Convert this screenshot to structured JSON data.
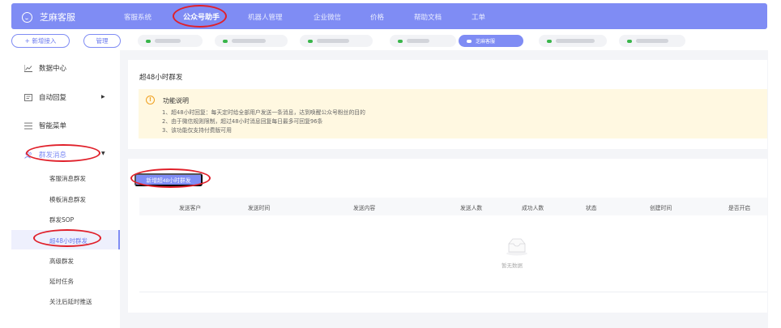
{
  "brand": {
    "name": "芝麻客服"
  },
  "nav": {
    "items": [
      {
        "label": "客服系统"
      },
      {
        "label": "公众号助手"
      },
      {
        "label": "机器人管理"
      },
      {
        "label": "企业微信"
      },
      {
        "label": "价格"
      },
      {
        "label": "帮助文档"
      },
      {
        "label": "工单"
      }
    ],
    "active_index": 1
  },
  "accounts": {
    "add_label": "+ 新增接入",
    "manage_label": "管理",
    "active_account_label": "芝麻客服"
  },
  "sidebar": {
    "items": [
      {
        "label": "数据中心",
        "icon": "chart-line-icon"
      },
      {
        "label": "自动回复",
        "icon": "message-square-icon"
      },
      {
        "label": "智能菜单",
        "icon": "menu-list-icon"
      },
      {
        "label": "群发消息",
        "icon": "user-group-icon"
      }
    ],
    "submenu": [
      {
        "label": "客服消息群发"
      },
      {
        "label": "模板消息群发"
      },
      {
        "label": "群发SOP"
      },
      {
        "label": "超48小时群发"
      },
      {
        "label": "高级群发"
      },
      {
        "label": "延时任务"
      },
      {
        "label": "关注后延时推送"
      }
    ],
    "active_submenu_index": 3
  },
  "page": {
    "title": "超48小时群发",
    "notice": {
      "title": "功能说明",
      "lines": [
        "1、超48小时回复：每天定时给全部用户发送一条消息，达到唤醒公众号粉丝的目的",
        "2、由于微信规则限制，超过48小时消息回复每日最多可回复96条",
        "3、该功能仅支持付费版可用"
      ]
    },
    "primary_button": "新增超48小时群发",
    "table": {
      "columns": [
        "发送客户",
        "发送时间",
        "发送内容",
        "发送人数",
        "成功人数",
        "状态",
        "创建时间",
        "是否开启"
      ],
      "empty_text": "暂无数据"
    }
  },
  "colors": {
    "accent": "#7f8cf4",
    "notice_bg": "#fff8e1",
    "warning": "#f0a020",
    "annotation": "#e0202a"
  }
}
